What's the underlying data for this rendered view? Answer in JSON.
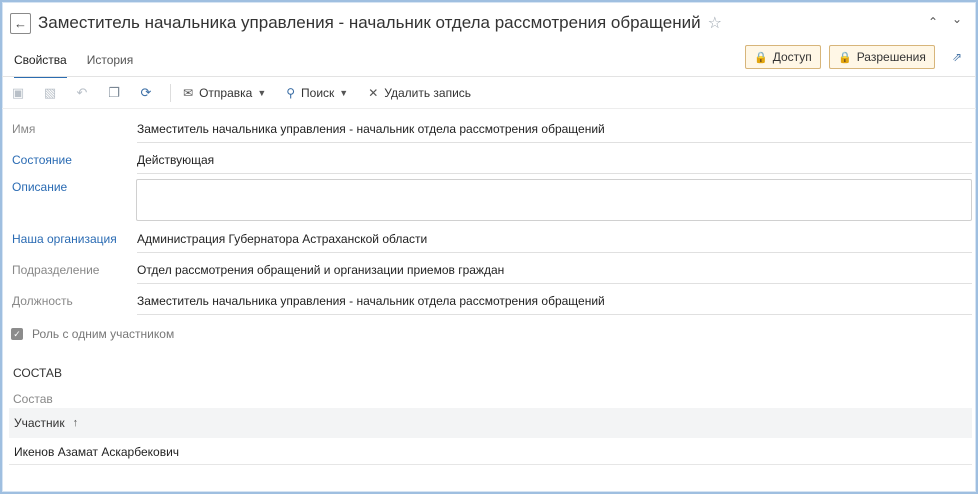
{
  "header": {
    "title": "Заместитель начальника управления - начальник отдела рассмотрения обращений",
    "back_icon": "arrow-left-icon",
    "star_icon": "star-outline-icon"
  },
  "tabs": [
    {
      "label": "Свойства",
      "active": true
    },
    {
      "label": "История",
      "active": false
    }
  ],
  "actions": {
    "access_label": "Доступ",
    "permissions_label": "Разрешения"
  },
  "toolbar": {
    "send_label": "Отправка",
    "search_label": "Поиск",
    "delete_label": "Удалить запись"
  },
  "fields": {
    "name_label": "Имя",
    "name_value": "Заместитель начальника управления - начальник отдела рассмотрения обращений",
    "state_label": "Состояние",
    "state_value": "Действующая",
    "description_label": "Описание",
    "description_value": "",
    "org_label": "Наша организация",
    "org_value": "Администрация Губернатора Астраханской области",
    "department_label": "Подразделение",
    "department_value": "Отдел рассмотрения обращений и организации приемов граждан",
    "position_label": "Должность",
    "position_value": "Заместитель начальника управления - начальник отдела рассмотрения обращений"
  },
  "single_participant": {
    "label": "Роль с одним участником",
    "checked": true
  },
  "composition": {
    "section_title": "СОСТАВ",
    "subsection_title": "Состав",
    "column_header": "Участник",
    "rows": [
      {
        "participant": "Икенов Азамат Аскарбекович"
      }
    ]
  },
  "colors": {
    "link": "#2a6bb3",
    "accent": "#2b6cb0",
    "lock": "#e0a000"
  }
}
